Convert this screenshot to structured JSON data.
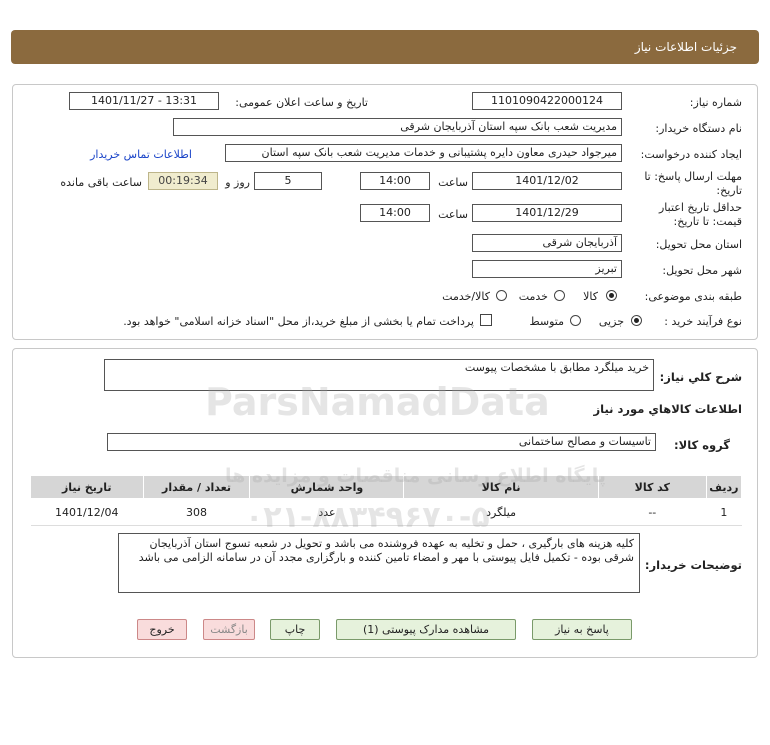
{
  "header": {
    "title": "جزئیات اطلاعات نیاز"
  },
  "form": {
    "need_number_label": "شماره نیاز:",
    "need_number": "1101090422000124",
    "announce_label": "تاریخ و ساعت اعلان عمومی:",
    "announce_value": "1401/11/27 - 13:31",
    "buyer_org_label": "نام دستگاه خریدار:",
    "buyer_org": "مدیریت شعب بانک سپه استان آذربایجان شرقی",
    "creator_label": "ایجاد کننده درخواست:",
    "creator": "میرجواد حیدری معاون دایره پشتیبانی و خدمات مدیریت شعب بانک سپه استان",
    "contact_link": "اطلاعات تماس خریدار",
    "reply_deadline_label_1": "مهلت ارسال پاسخ: تا",
    "reply_deadline_label_2": "تاریخ:",
    "reply_date": "1401/12/02",
    "time_label": "ساعت",
    "reply_time": "14:00",
    "days_value": "5",
    "days_label": "روز و",
    "remaining_time": "00:19:34",
    "remaining_label": "ساعت باقی مانده",
    "validity_label_1": "حداقل تاریخ اعتبار",
    "validity_label_2": "قیمت: تا تاریخ:",
    "validity_date": "1401/12/29",
    "validity_time_label": "ساعت",
    "validity_time": "14:00",
    "province_label": "استان محل تحویل:",
    "province": "آذربایجان شرقی",
    "city_label": "شهر محل تحویل:",
    "city": "تبریز",
    "category_label": "طبقه بندی موضوعی:",
    "category_options": [
      "کالا",
      "خدمت",
      "کالا/خدمت"
    ],
    "process_label": "نوع فرآیند خرید :",
    "process_options": [
      "جزیی",
      "متوسط"
    ],
    "payment_note": "پرداخت تمام یا بخشی از مبلغ خرید،از محل \"اسناد خزانه اسلامی\" خواهد بود."
  },
  "summary": {
    "label": "شرح کلي نياز:",
    "value": "خرید میلگرد مطابق با مشخصات پیوست",
    "items_heading": "اطلاعات کالاهاي مورد نياز",
    "group_label": "گروه کالا:",
    "group_value": "تاسیسات و مصالح ساختمانی"
  },
  "table": {
    "headers": [
      "ردیف",
      "کد کالا",
      "نام کالا",
      "واحد شمارش",
      "تعداد / مقدار",
      "تاریخ نیاز"
    ],
    "rows": [
      [
        "1",
        "--",
        "میلگرد",
        "عدد",
        "308",
        "1401/12/04"
      ]
    ]
  },
  "buyer_notes": {
    "label": "توضیحات خریدار:",
    "text": "کلیه هزینه های بارگیری ، حمل و تخلیه به عهده فروشنده می باشد و تحویل در شعبه تسوج استان آذربایجان شرقی بوده - تکمیل فایل پیوستی با مهر و امضاء تامین کننده و بارگزاری مجدد آن در سامانه الزامی می باشد"
  },
  "buttons": {
    "reply": "پاسخ به نیاز",
    "attachments": "مشاهده مدارک پیوستی (1)",
    "print": "چاپ",
    "back": "بازگشت",
    "exit": "خروج"
  },
  "watermark": {
    "brand": "ParsNamadData",
    "subtitle": "پایگاه اطلاع رسانی مناقصات و مزایده ها",
    "phone": "۰۲۱-۸۸۳۴۹۶۷۰-۵"
  }
}
